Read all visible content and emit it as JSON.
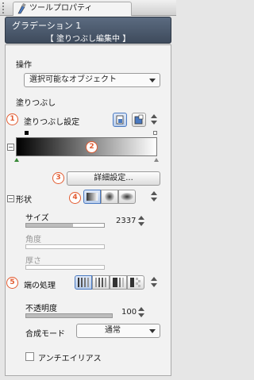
{
  "window": {
    "tab_title": "ツールプロパティ"
  },
  "tool": {
    "name": "グラデーション 1",
    "sub_tool": "【 塗りつぶし編集中 】"
  },
  "operation": {
    "label": "操作",
    "value": "選択可能なオブジェクト"
  },
  "fill": {
    "section_label": "塗りつぶし",
    "setting_label": "塗りつぶし設定",
    "detail_button": "詳細設定..."
  },
  "shape": {
    "label": "形状"
  },
  "size": {
    "label": "サイズ",
    "value": "2337",
    "fill_fraction": 0.6
  },
  "angle": {
    "label": "角度"
  },
  "thickness": {
    "label": "厚さ"
  },
  "edge": {
    "label": "端の処理"
  },
  "opacity": {
    "label": "不透明度",
    "value": "100",
    "fill_fraction": 1.0
  },
  "blend": {
    "label": "合成モード",
    "value": "通常"
  },
  "antialias": {
    "label": "アンチエイリアス"
  },
  "badges": [
    "1",
    "2",
    "3",
    "4",
    "5"
  ],
  "colors": {
    "badge": "#e25b30",
    "header": "#4c5a6d",
    "accent": "#4a79c0"
  }
}
